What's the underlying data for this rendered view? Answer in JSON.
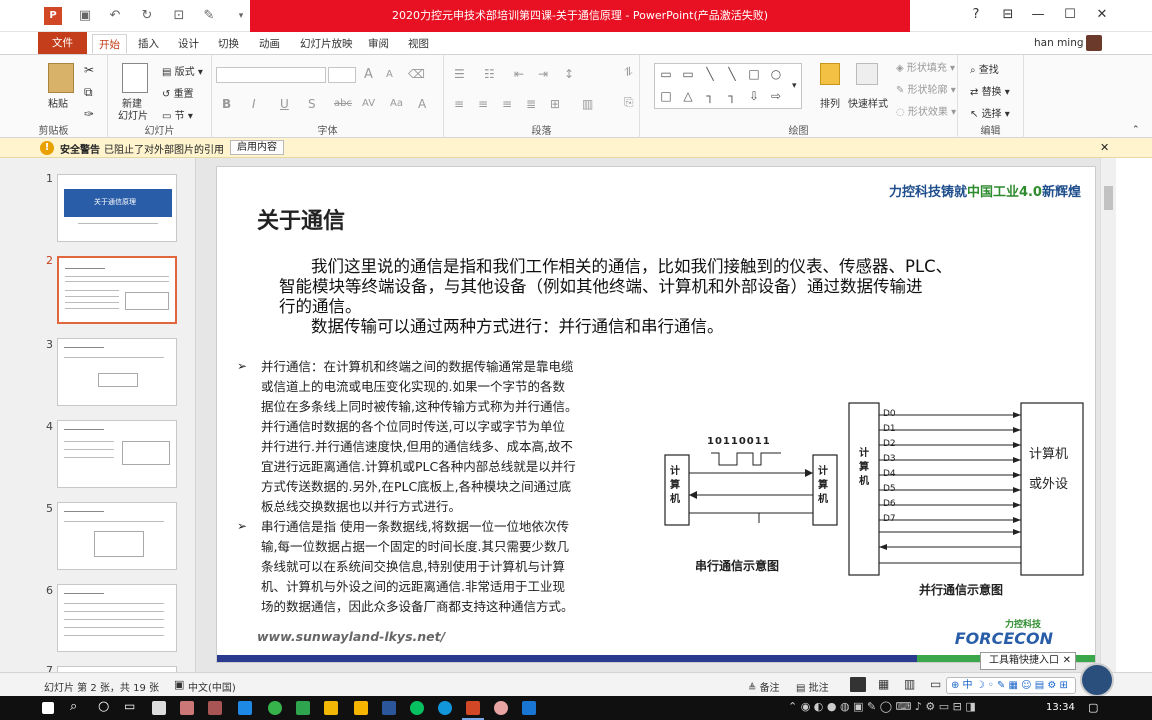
{
  "window": {
    "title": "2020力控元申技术部培训第四课-关于通信原理 - PowerPoint(产品激活失败)",
    "help": "?",
    "user": "han ming",
    "min": "—",
    "max": "☐",
    "close": "✕"
  },
  "tabs": [
    "文件",
    "开始",
    "插入",
    "设计",
    "切换",
    "动画",
    "幻灯片放映",
    "审阅",
    "视图"
  ],
  "ribbon": {
    "clipboard": {
      "paste": "粘贴",
      "label": "剪贴板"
    },
    "slides": {
      "new_slide_line1": "新建",
      "new_slide_line2": "幻灯片",
      "layout": "版式",
      "reset": "重置",
      "section": "节",
      "label": "幻灯片"
    },
    "font": {
      "label": "字体",
      "bold": "B",
      "italic": "I",
      "underline": "U",
      "shadow": "S",
      "strike": "abc",
      "spacing": "AV",
      "case": "Aa",
      "size_up": "A",
      "size_down": "A"
    },
    "paragraph": {
      "label": "段落"
    },
    "drawing": {
      "arrange": "排列",
      "quick_styles": "快速样式",
      "fill": "形状填充",
      "outline": "形状轮廓",
      "effects": "形状效果",
      "label": "绘图"
    },
    "editing": {
      "find": "查找",
      "replace": "替换",
      "select": "选择",
      "label": "编辑"
    }
  },
  "warning": {
    "title": "安全警告",
    "message": "已阻止了对外部图片的引用",
    "button": "启用内容"
  },
  "thumbnails": [
    "1",
    "2",
    "3",
    "4",
    "5",
    "6",
    "7"
  ],
  "selected_slide": 2,
  "thumb1_title": "关于通信原理",
  "slide": {
    "brand_a": "力控科技铸就",
    "brand_b": "中国工业4.0",
    "brand_c": "新辉煌",
    "title": "关于通信",
    "para1_line1": "我们这里说的通信是指和我们工作相关的通信，比如我们接触到的仪表、传感器、PLC、",
    "para1_line2": "智能模块等终端设备，与其他设备（例如其他终端、计算机和外部设备）通过数据传输进",
    "para1_line3": "行的通信。",
    "para2": "数据传输可以通过两种方式进行：并行通信和串行通信。",
    "bullet1": [
      "并行通信：在计算机和终端之间的数据传输通常是靠电缆",
      "或信道上的电流或电压变化实现的.如果一个字节的各数",
      "据位在多条线上同时被传输,这种传输方式称为并行通信。",
      "并行通信时数据的各个位同时传送,可以字或字节为单位",
      "并行进行.并行通信速度快,但用的通信线多、成本高,故不",
      "宜进行远距离通信.计算机或PLC各种内部总线就是以并行",
      "方式传送数据的.另外,在PLC底板上,各种模块之间通过底",
      "板总线交换数据也以并行方式进行。"
    ],
    "bullet2": [
      "串行通信是指 使用一条数据线,将数据一位一位地依次传",
      "输,每一位数据占据一个固定的时间长度.其只需要少数几",
      "条线就可以在系统间交换信息,特别使用于计算机与计算",
      "机、计算机与外设之间的远距离通信.非常适用于工业现",
      "场的数据通信，因此众多设备厂商都支持这种通信方式。"
    ],
    "serial_bits": "10110011",
    "serial_left": "计算机",
    "serial_right": "计算机",
    "serial_caption": "串行通信示意图",
    "parallel_left": "计算机",
    "parallel_right_1": "计算机",
    "parallel_right_2": "或外设",
    "parallel_lines": [
      "D0",
      "D1",
      "D2",
      "D3",
      "D4",
      "D5",
      "D6",
      "D7"
    ],
    "parallel_caption": "并行通信示意图",
    "url": "www.sunwayland-lkys.net/",
    "logo_cn": "力控科技",
    "logo_en": "FORCECON"
  },
  "status": {
    "slide_info": "幻灯片 第 2 张，共 19 张",
    "language": "中文(中国)",
    "notes": "备注",
    "comments": "批注",
    "tooltip": "工具箱快捷入口"
  },
  "taskbar": {
    "time": "13:34"
  }
}
